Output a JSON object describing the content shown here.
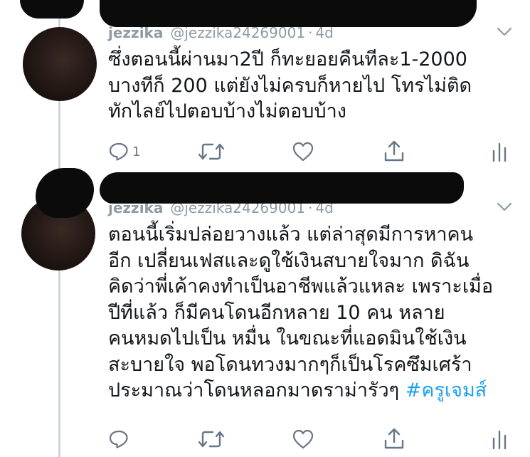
{
  "colors": {
    "text": "#14171a",
    "muted": "#8e9aa4",
    "icon": "#657786",
    "link": "#1da1f2",
    "thread_line": "#ccd6dd"
  },
  "tweets": [
    {
      "display_name": "jezzika",
      "handle": "@jezzika24269001",
      "separator": "·",
      "time": "4d",
      "text": "ซึ่งตอนนี้ผ่านมา2ปี ก็ทะยอยคืนทีละ1-2000\nบางทีก็ 200 แต่ยังไม่ครบก็หายไป โทรไม่ติด\nทักไลย์ไปตอบบ้างไม่ตอบบ้าง",
      "reply_count": "1",
      "icons": {
        "reply": "reply-icon",
        "retweet": "retweet-icon",
        "like": "heart-icon",
        "share": "share-icon",
        "analytics": "analytics-icon",
        "menu": "chevron-down-icon"
      }
    },
    {
      "display_name": "jezzika",
      "handle": "@jezzika24269001",
      "separator": "·",
      "time": "4d",
      "text": "ตอนนี้เริ่มปล่อยวางแล้ว แต่ล่าสุดมีการหาคน\nอีก เปลี่ยนเฟสและดูใช้เงินสบายใจมาก ดิฉัน\nคิดว่าพี่เค้าคงทำเป็นอาชีพแล้วแหละ เพราะเมื่อ\nปีที่แล้ว ก็มีคนโดนอีกหลาย 10 คน หลาย\nคนหมดไปเป็น หมื่น ในขณะที่แอดมินใช้เงิน\nสะบายใจ พอโดนทวงมากๆก็เป็นโรคซึมเศร้า\nประมาณว่าโดนหลอกมาดราม่ารัวๆ ",
      "hashtag": "#ครูเจมส์",
      "reply_count": "",
      "icons": {
        "reply": "reply-icon",
        "retweet": "retweet-icon",
        "like": "heart-icon",
        "share": "share-icon",
        "analytics": "analytics-icon",
        "menu": "chevron-down-icon"
      }
    }
  ]
}
